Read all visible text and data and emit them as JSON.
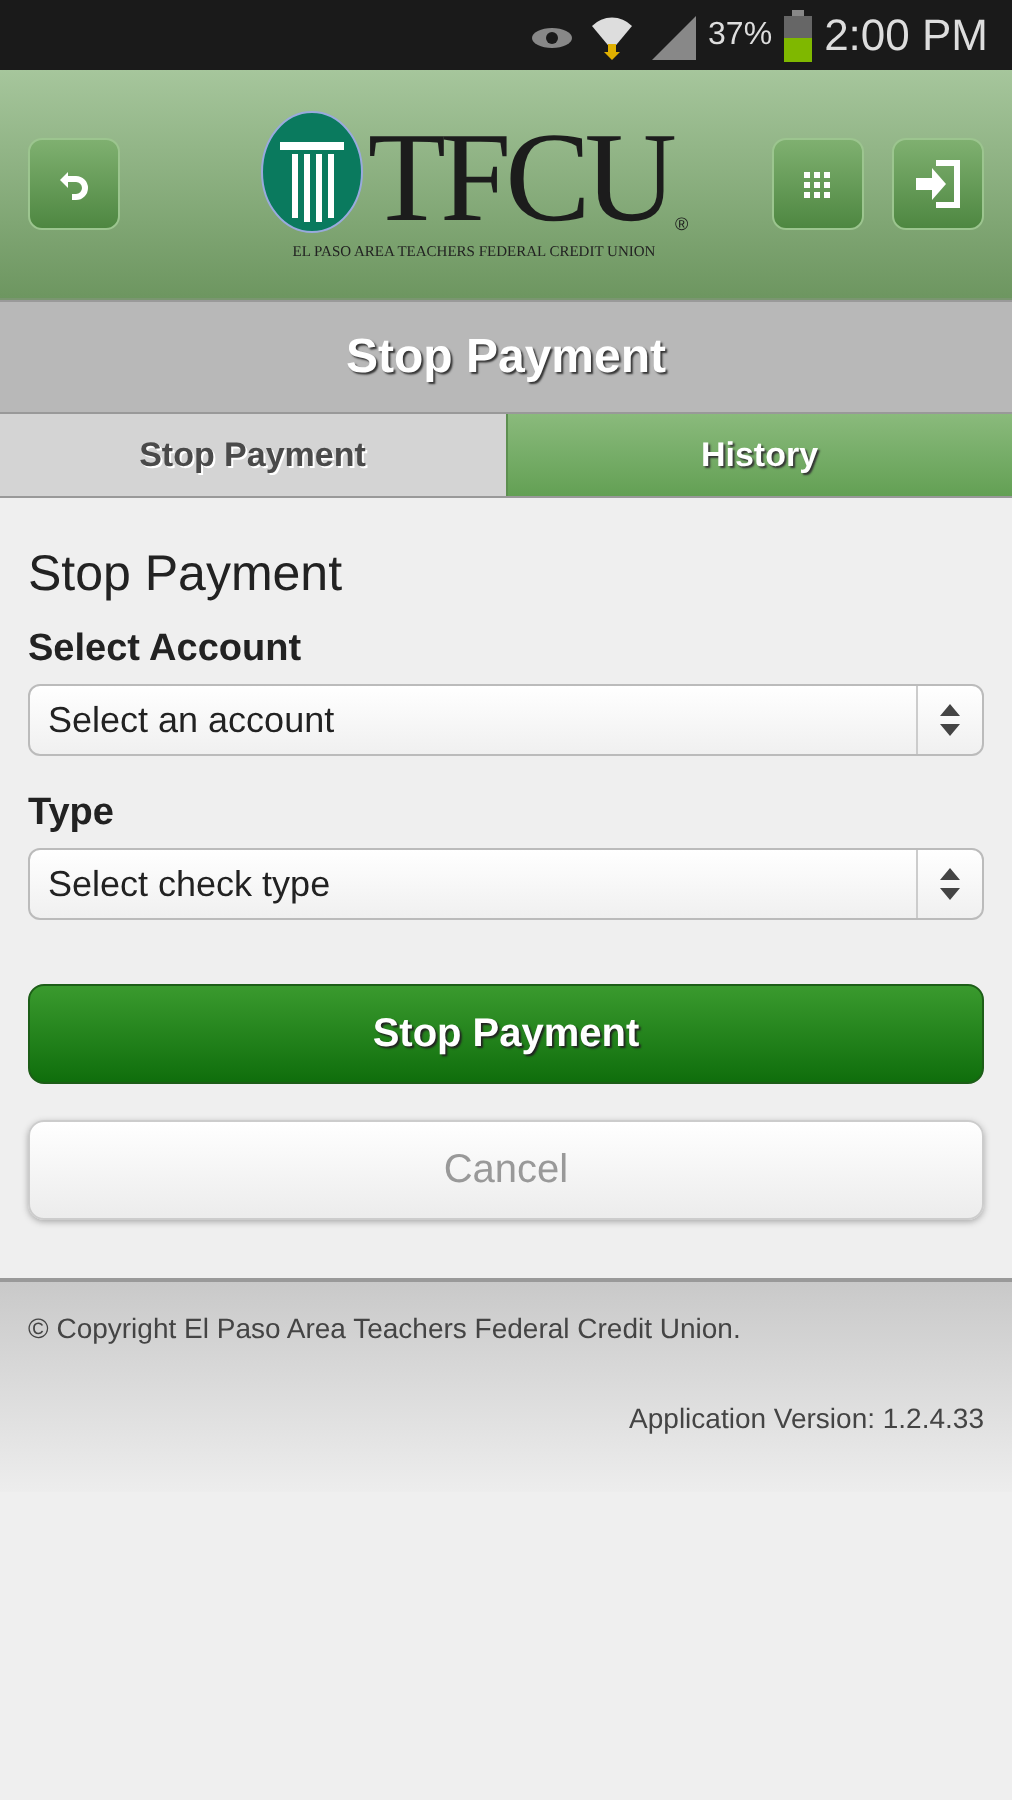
{
  "status_bar": {
    "battery": "37%",
    "time": "2:00 PM"
  },
  "header": {
    "logo_text": "TFCU",
    "logo_mark": "®",
    "logo_subtitle": "EL PASO AREA TEACHERS FEDERAL CREDIT UNION"
  },
  "page_title": "Stop Payment",
  "tabs": [
    {
      "label": "Stop Payment",
      "selected": true
    },
    {
      "label": "History",
      "selected": false
    }
  ],
  "form": {
    "heading": "Stop Payment",
    "fields": [
      {
        "label": "Select Account",
        "value": "Select an account"
      },
      {
        "label": "Type",
        "value": "Select check type"
      }
    ],
    "buttons": [
      {
        "label": "Stop Payment",
        "kind": "primary"
      },
      {
        "label": "Cancel",
        "kind": "secondary"
      }
    ]
  },
  "footer": {
    "copyright": "© Copyright El Paso Area Teachers Federal Credit Union.",
    "version": "Application Version: 1.2.4.33"
  }
}
